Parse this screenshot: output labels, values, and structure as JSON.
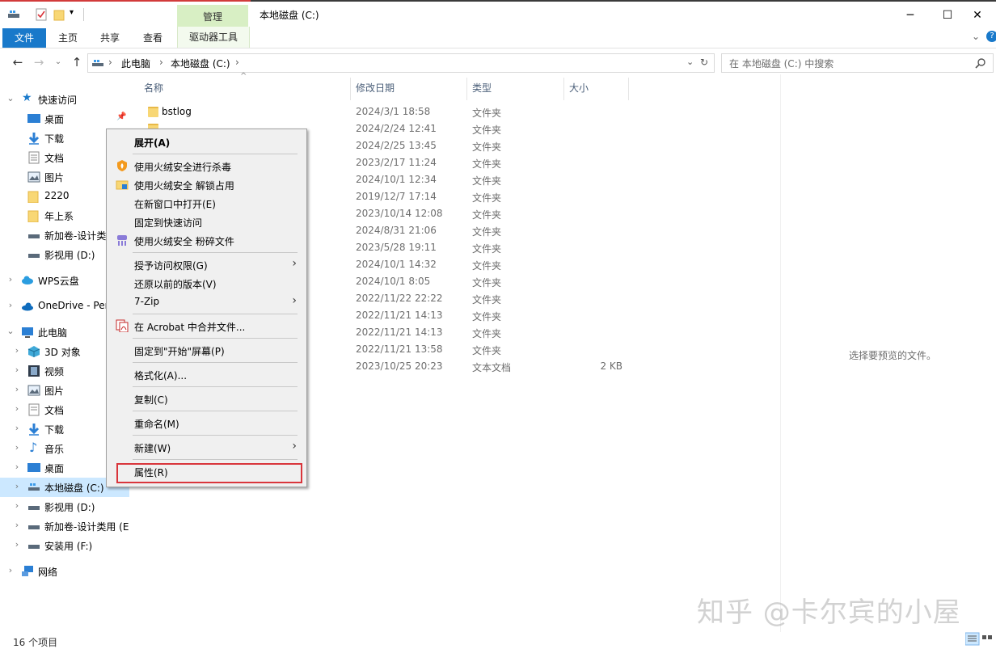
{
  "titlebar": {
    "manage_tab": "管理",
    "window_title": "本地磁盘 (C:)"
  },
  "ribbon": {
    "file": "文件",
    "home": "主页",
    "share": "共享",
    "view": "查看",
    "drive_tools": "驱动器工具"
  },
  "address": {
    "crumbs": [
      "此电脑",
      "本地磁盘 (C:)"
    ],
    "search_placeholder": "在 本地磁盘 (C:) 中搜索"
  },
  "nav": {
    "quick_access": "快速访问",
    "quick_items": [
      "桌面",
      "下载",
      "文档",
      "图片",
      "2220",
      "年上系",
      "新加卷-设计类",
      "影视用 (D:)"
    ],
    "wps": "WPS云盘",
    "onedrive": "OneDrive - Per",
    "this_pc": "此电脑",
    "pc_items": [
      "3D 对象",
      "视频",
      "图片",
      "文档",
      "下载",
      "音乐",
      "桌面",
      "本地磁盘 (C:)",
      "影视用 (D:)",
      "新加卷-设计类用 (E",
      "安装用 (F:)"
    ],
    "network": "网络"
  },
  "columns": {
    "name": "名称",
    "date": "修改日期",
    "type": "类型",
    "size": "大小"
  },
  "files": [
    {
      "name": "bstlog",
      "date": "2024/3/1 18:58",
      "type": "文件夹",
      "size": ""
    },
    {
      "name": "",
      "date": "2024/2/24 12:41",
      "type": "文件夹",
      "size": ""
    },
    {
      "name": "",
      "date": "2024/2/25 13:45",
      "type": "文件夹",
      "size": ""
    },
    {
      "name": "",
      "date": "2023/2/17 11:24",
      "type": "文件夹",
      "size": ""
    },
    {
      "name": "",
      "date": "2024/10/1 12:34",
      "type": "文件夹",
      "size": ""
    },
    {
      "name": "",
      "date": "2019/12/7 17:14",
      "type": "文件夹",
      "size": ""
    },
    {
      "name": "",
      "date": "2023/10/14 12:08",
      "type": "文件夹",
      "size": ""
    },
    {
      "name": "",
      "date": "2024/8/31 21:06",
      "type": "文件夹",
      "size": ""
    },
    {
      "name": "",
      "date": "2023/5/28 19:11",
      "type": "文件夹",
      "size": ""
    },
    {
      "name": "",
      "date": "2024/10/1 14:32",
      "type": "文件夹",
      "size": ""
    },
    {
      "name": "",
      "date": "2024/10/1 8:05",
      "type": "文件夹",
      "size": ""
    },
    {
      "name": "",
      "date": "2022/11/22 22:22",
      "type": "文件夹",
      "size": ""
    },
    {
      "name": "",
      "date": "2022/11/21 14:13",
      "type": "文件夹",
      "size": ""
    },
    {
      "name": "",
      "date": "2022/11/21 14:13",
      "type": "文件夹",
      "size": ""
    },
    {
      "name": "",
      "date": "2022/11/21 13:58",
      "type": "文件夹",
      "size": ""
    },
    {
      "name": "",
      "date": "2023/10/25 20:23",
      "type": "文本文档",
      "size": "2 KB"
    }
  ],
  "context_menu": {
    "expand": "展开(A)",
    "scan": "使用火绒安全进行杀毒",
    "unlock": "使用火绒安全 解锁占用",
    "open_new_window": "在新窗口中打开(E)",
    "pin_quick": "固定到快速访问",
    "shred": "使用火绒安全 粉碎文件",
    "grant_access": "授予访问权限(G)",
    "restore_prev": "还原以前的版本(V)",
    "zip": "7-Zip",
    "acrobat": "在 Acrobat 中合并文件...",
    "pin_start": "固定到\"开始\"屏幕(P)",
    "format": "格式化(A)...",
    "copy": "复制(C)",
    "rename": "重命名(M)",
    "new": "新建(W)",
    "properties": "属性(R)"
  },
  "preview_text": "选择要预览的文件。",
  "status": {
    "item_count": "16 个项目"
  },
  "watermark": "知乎 @卡尔宾的小屋",
  "colors": {
    "accent": "#1979ca",
    "highlight": "#d9353b",
    "manage_tab": "#d8efc4",
    "selection": "#cce8ff"
  }
}
